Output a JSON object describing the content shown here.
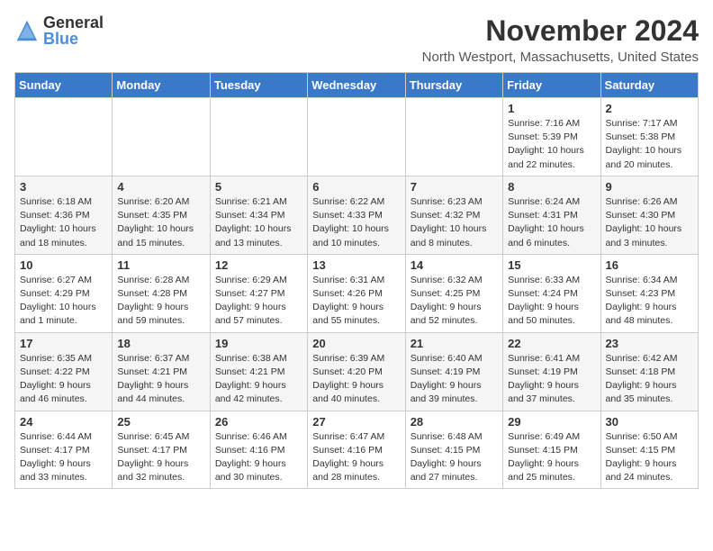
{
  "logo": {
    "text_general": "General",
    "text_blue": "Blue"
  },
  "title": "November 2024",
  "location": "North Westport, Massachusetts, United States",
  "days_of_week": [
    "Sunday",
    "Monday",
    "Tuesday",
    "Wednesday",
    "Thursday",
    "Friday",
    "Saturday"
  ],
  "weeks": [
    [
      {
        "day": "",
        "info": ""
      },
      {
        "day": "",
        "info": ""
      },
      {
        "day": "",
        "info": ""
      },
      {
        "day": "",
        "info": ""
      },
      {
        "day": "",
        "info": ""
      },
      {
        "day": "1",
        "info": "Sunrise: 7:16 AM\nSunset: 5:39 PM\nDaylight: 10 hours and 22 minutes."
      },
      {
        "day": "2",
        "info": "Sunrise: 7:17 AM\nSunset: 5:38 PM\nDaylight: 10 hours and 20 minutes."
      }
    ],
    [
      {
        "day": "3",
        "info": "Sunrise: 6:18 AM\nSunset: 4:36 PM\nDaylight: 10 hours and 18 minutes."
      },
      {
        "day": "4",
        "info": "Sunrise: 6:20 AM\nSunset: 4:35 PM\nDaylight: 10 hours and 15 minutes."
      },
      {
        "day": "5",
        "info": "Sunrise: 6:21 AM\nSunset: 4:34 PM\nDaylight: 10 hours and 13 minutes."
      },
      {
        "day": "6",
        "info": "Sunrise: 6:22 AM\nSunset: 4:33 PM\nDaylight: 10 hours and 10 minutes."
      },
      {
        "day": "7",
        "info": "Sunrise: 6:23 AM\nSunset: 4:32 PM\nDaylight: 10 hours and 8 minutes."
      },
      {
        "day": "8",
        "info": "Sunrise: 6:24 AM\nSunset: 4:31 PM\nDaylight: 10 hours and 6 minutes."
      },
      {
        "day": "9",
        "info": "Sunrise: 6:26 AM\nSunset: 4:30 PM\nDaylight: 10 hours and 3 minutes."
      }
    ],
    [
      {
        "day": "10",
        "info": "Sunrise: 6:27 AM\nSunset: 4:29 PM\nDaylight: 10 hours and 1 minute."
      },
      {
        "day": "11",
        "info": "Sunrise: 6:28 AM\nSunset: 4:28 PM\nDaylight: 9 hours and 59 minutes."
      },
      {
        "day": "12",
        "info": "Sunrise: 6:29 AM\nSunset: 4:27 PM\nDaylight: 9 hours and 57 minutes."
      },
      {
        "day": "13",
        "info": "Sunrise: 6:31 AM\nSunset: 4:26 PM\nDaylight: 9 hours and 55 minutes."
      },
      {
        "day": "14",
        "info": "Sunrise: 6:32 AM\nSunset: 4:25 PM\nDaylight: 9 hours and 52 minutes."
      },
      {
        "day": "15",
        "info": "Sunrise: 6:33 AM\nSunset: 4:24 PM\nDaylight: 9 hours and 50 minutes."
      },
      {
        "day": "16",
        "info": "Sunrise: 6:34 AM\nSunset: 4:23 PM\nDaylight: 9 hours and 48 minutes."
      }
    ],
    [
      {
        "day": "17",
        "info": "Sunrise: 6:35 AM\nSunset: 4:22 PM\nDaylight: 9 hours and 46 minutes."
      },
      {
        "day": "18",
        "info": "Sunrise: 6:37 AM\nSunset: 4:21 PM\nDaylight: 9 hours and 44 minutes."
      },
      {
        "day": "19",
        "info": "Sunrise: 6:38 AM\nSunset: 4:21 PM\nDaylight: 9 hours and 42 minutes."
      },
      {
        "day": "20",
        "info": "Sunrise: 6:39 AM\nSunset: 4:20 PM\nDaylight: 9 hours and 40 minutes."
      },
      {
        "day": "21",
        "info": "Sunrise: 6:40 AM\nSunset: 4:19 PM\nDaylight: 9 hours and 39 minutes."
      },
      {
        "day": "22",
        "info": "Sunrise: 6:41 AM\nSunset: 4:19 PM\nDaylight: 9 hours and 37 minutes."
      },
      {
        "day": "23",
        "info": "Sunrise: 6:42 AM\nSunset: 4:18 PM\nDaylight: 9 hours and 35 minutes."
      }
    ],
    [
      {
        "day": "24",
        "info": "Sunrise: 6:44 AM\nSunset: 4:17 PM\nDaylight: 9 hours and 33 minutes."
      },
      {
        "day": "25",
        "info": "Sunrise: 6:45 AM\nSunset: 4:17 PM\nDaylight: 9 hours and 32 minutes."
      },
      {
        "day": "26",
        "info": "Sunrise: 6:46 AM\nSunset: 4:16 PM\nDaylight: 9 hours and 30 minutes."
      },
      {
        "day": "27",
        "info": "Sunrise: 6:47 AM\nSunset: 4:16 PM\nDaylight: 9 hours and 28 minutes."
      },
      {
        "day": "28",
        "info": "Sunrise: 6:48 AM\nSunset: 4:15 PM\nDaylight: 9 hours and 27 minutes."
      },
      {
        "day": "29",
        "info": "Sunrise: 6:49 AM\nSunset: 4:15 PM\nDaylight: 9 hours and 25 minutes."
      },
      {
        "day": "30",
        "info": "Sunrise: 6:50 AM\nSunset: 4:15 PM\nDaylight: 9 hours and 24 minutes."
      }
    ]
  ]
}
